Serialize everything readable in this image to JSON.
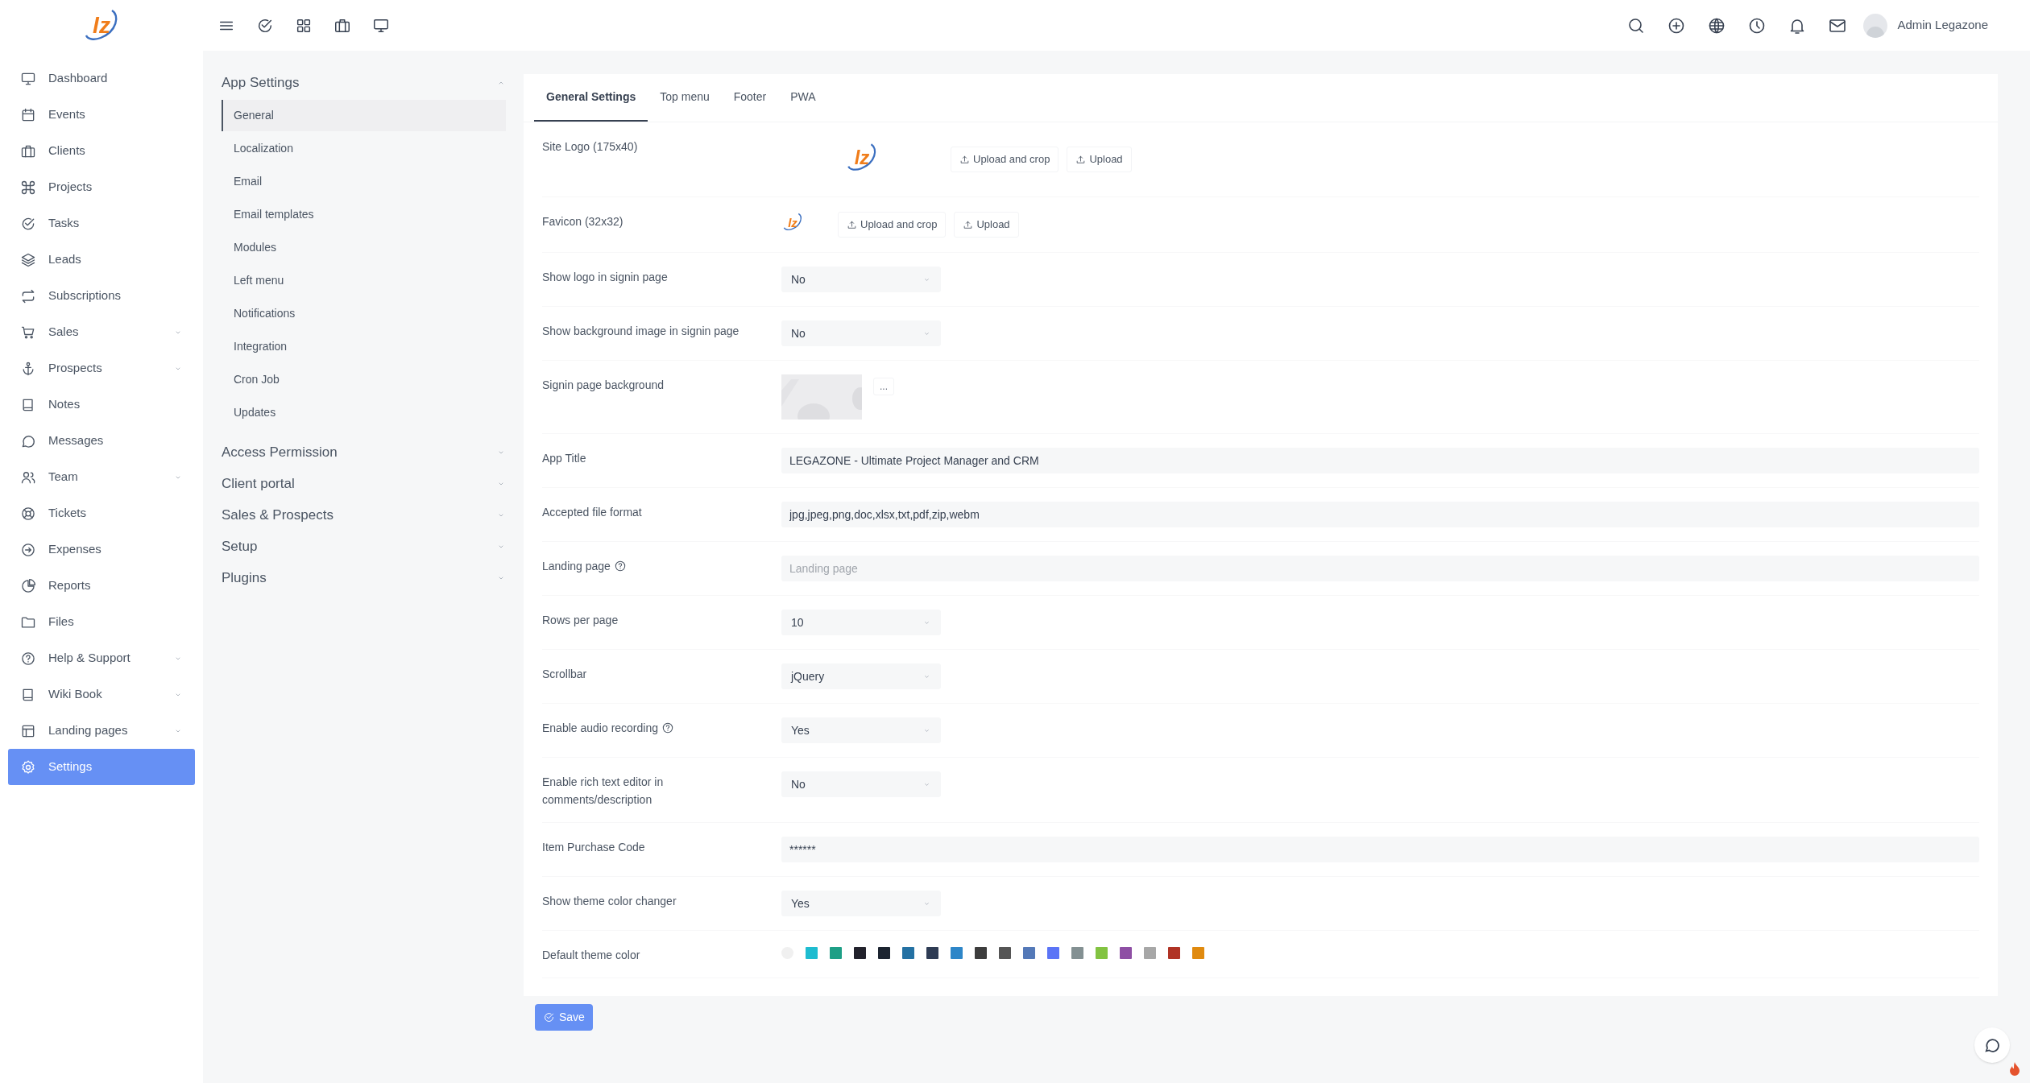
{
  "brand": {
    "logo_text": "lz"
  },
  "top_bar": {
    "user_name": "Admin Legazone"
  },
  "sidebar": {
    "items": [
      {
        "label": "Dashboard",
        "has_submenu": false,
        "selected": false
      },
      {
        "label": "Events",
        "has_submenu": false,
        "selected": false
      },
      {
        "label": "Clients",
        "has_submenu": false,
        "selected": false
      },
      {
        "label": "Projects",
        "has_submenu": false,
        "selected": false
      },
      {
        "label": "Tasks",
        "has_submenu": false,
        "selected": false
      },
      {
        "label": "Leads",
        "has_submenu": false,
        "selected": false
      },
      {
        "label": "Subscriptions",
        "has_submenu": false,
        "selected": false
      },
      {
        "label": "Sales",
        "has_submenu": true,
        "selected": false
      },
      {
        "label": "Prospects",
        "has_submenu": true,
        "selected": false
      },
      {
        "label": "Notes",
        "has_submenu": false,
        "selected": false
      },
      {
        "label": "Messages",
        "has_submenu": false,
        "selected": false
      },
      {
        "label": "Team",
        "has_submenu": true,
        "selected": false
      },
      {
        "label": "Tickets",
        "has_submenu": false,
        "selected": false
      },
      {
        "label": "Expenses",
        "has_submenu": false,
        "selected": false
      },
      {
        "label": "Reports",
        "has_submenu": false,
        "selected": false
      },
      {
        "label": "Files",
        "has_submenu": false,
        "selected": false
      },
      {
        "label": "Help & Support",
        "has_submenu": true,
        "selected": false
      },
      {
        "label": "Wiki Book",
        "has_submenu": true,
        "selected": false
      },
      {
        "label": "Landing pages",
        "has_submenu": true,
        "selected": false
      },
      {
        "label": "Settings",
        "has_submenu": false,
        "selected": true
      }
    ]
  },
  "settings_menu": [
    {
      "label": "App Settings",
      "expanded": true,
      "children": [
        {
          "label": "General",
          "selected": true
        },
        {
          "label": "Localization",
          "selected": false
        },
        {
          "label": "Email",
          "selected": false
        },
        {
          "label": "Email templates",
          "selected": false
        },
        {
          "label": "Modules",
          "selected": false
        },
        {
          "label": "Left menu",
          "selected": false
        },
        {
          "label": "Notifications",
          "selected": false
        },
        {
          "label": "Integration",
          "selected": false
        },
        {
          "label": "Cron Job",
          "selected": false
        },
        {
          "label": "Updates",
          "selected": false
        }
      ]
    },
    {
      "label": "Access Permission",
      "expanded": false
    },
    {
      "label": "Client portal",
      "expanded": false
    },
    {
      "label": "Sales & Prospects",
      "expanded": false
    },
    {
      "label": "Setup",
      "expanded": false
    },
    {
      "label": "Plugins",
      "expanded": false
    }
  ],
  "tabs": [
    {
      "label": "General Settings",
      "selected": true
    },
    {
      "label": "Top menu",
      "selected": false
    },
    {
      "label": "Footer",
      "selected": false
    },
    {
      "label": "PWA",
      "selected": false
    }
  ],
  "form": [
    {
      "kind": "logo_upload",
      "label": "Site Logo (175x40)",
      "image_text": "lz",
      "buttons": [
        "Upload and crop",
        "Upload"
      ]
    },
    {
      "kind": "favicon_upload",
      "label": "Favicon (32x32)",
      "image_text": "lz",
      "buttons": [
        "Upload and crop",
        "Upload"
      ]
    },
    {
      "kind": "select",
      "label": "Show logo in signin page",
      "value": "No"
    },
    {
      "kind": "select",
      "label": "Show background image in signin page",
      "value": "No"
    },
    {
      "kind": "image_picker",
      "label": "Signin page background",
      "button": "..."
    },
    {
      "kind": "text",
      "label": "App Title",
      "value": "LEGAZONE - Ultimate Project Manager and CRM"
    },
    {
      "kind": "text",
      "label": "Accepted file format",
      "value": "jpg,jpeg,png,doc,xlsx,txt,pdf,zip,webm"
    },
    {
      "kind": "text",
      "label": "Landing page",
      "help": true,
      "placeholder": "Landing page"
    },
    {
      "kind": "select",
      "label": "Rows per page",
      "value": "10"
    },
    {
      "kind": "select",
      "label": "Scrollbar",
      "value": "jQuery"
    },
    {
      "kind": "select",
      "label": "Enable audio recording",
      "help": true,
      "value": "Yes"
    },
    {
      "kind": "select",
      "label": "Enable rich text editor in comments/description",
      "value": "No"
    },
    {
      "kind": "text",
      "label": "Item Purchase Code",
      "value": "******"
    },
    {
      "kind": "select",
      "label": "Show theme color changer",
      "value": "Yes"
    },
    {
      "kind": "colors",
      "label": "Default theme color",
      "colors": [
        {
          "color": "#f0f0f0"
        },
        {
          "color": "#1ebcd0"
        },
        {
          "color": "#1e9f86"
        },
        {
          "color": "#22222c"
        },
        {
          "color": "#1c2430"
        },
        {
          "color": "#2471a3"
        },
        {
          "color": "#2e3c54"
        },
        {
          "color": "#2e86c8"
        },
        {
          "color": "#3d3d3d"
        },
        {
          "color": "#555555"
        },
        {
          "color": "#5479b8"
        },
        {
          "color": "#5b74f6"
        },
        {
          "color": "#839092"
        },
        {
          "color": "#82c341"
        },
        {
          "color": "#8e4fa4"
        },
        {
          "color": "#a7a7a7"
        },
        {
          "color": "#b03325"
        },
        {
          "color": "#e08a0f"
        }
      ]
    }
  ],
  "save_button": "Save"
}
